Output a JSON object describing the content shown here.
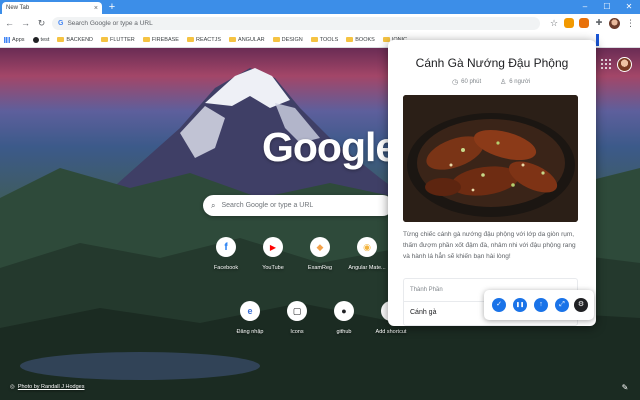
{
  "browser": {
    "tab": {
      "title": "New Tab",
      "close": "×"
    },
    "new_tab": "+",
    "window_controls": {
      "minimize": "–",
      "maximize": "☐",
      "close": "✕"
    },
    "omnibox": {
      "placeholder": "Search Google or type a URL"
    },
    "bookmarks": [
      {
        "label": "Apps",
        "icon": "apps-grid-icon"
      },
      {
        "label": "test",
        "icon": "site-icon"
      },
      {
        "label": "BACKEND",
        "icon": "folder-icon"
      },
      {
        "label": "FLUTTER",
        "icon": "folder-icon"
      },
      {
        "label": "FIREBASE",
        "icon": "folder-icon"
      },
      {
        "label": "REACTJS",
        "icon": "folder-icon"
      },
      {
        "label": "ANGULAR",
        "icon": "folder-icon"
      },
      {
        "label": "DESIGN",
        "icon": "folder-icon"
      },
      {
        "label": "TOOLS",
        "icon": "folder-icon"
      },
      {
        "label": "BOOKS",
        "icon": "folder-icon"
      },
      {
        "label": "IONIC",
        "icon": "folder-icon"
      }
    ]
  },
  "ntp": {
    "logo": "Google",
    "search_placeholder": "Search Google or type a URL",
    "shortcuts_row1": [
      {
        "label": "Facebook",
        "glyph": "f",
        "color": "#1877f2"
      },
      {
        "label": "YouTube",
        "glyph": "▶",
        "color": "#ff0000"
      },
      {
        "label": "ExamReg",
        "glyph": "◆",
        "color": "#f4a14a"
      },
      {
        "label": "Angular Mate...",
        "glyph": "◉",
        "color": "#f2b33d"
      }
    ],
    "shortcuts_row2": [
      {
        "label": "Đăng nhập",
        "glyph": "e",
        "color": "#3b6fd4"
      },
      {
        "label": "Icons",
        "glyph": "▢",
        "color": "#202124"
      },
      {
        "label": "github",
        "glyph": "●",
        "color": "#202124"
      },
      {
        "label": "Add shortcut",
        "glyph": "+",
        "color": "#202124"
      }
    ],
    "photo_credit": "Photo by Randall J Hodges",
    "photo_credit_icon": "◎",
    "edit_icon": "✎"
  },
  "recipe": {
    "title": "Cánh Gà Nướng Đậu Phộng",
    "time": "60 phút",
    "servings": "6 người",
    "description": "Từng chiếc cánh gà nướng đậu phộng với lớp da giòn rụm, thấm đượm phần xốt đậm đà, nhâm nhi với đậu phộng rang và hành lá hẳn sẽ khiến bạn hài lòng!",
    "ingredients_header": "Thành Phần",
    "ingredients": [
      "Cánh gà"
    ]
  },
  "fab_buttons": [
    {
      "icon": "check-icon",
      "glyph": "✓"
    },
    {
      "icon": "pause-icon",
      "glyph": "❚❚"
    },
    {
      "icon": "arrow-up-icon",
      "glyph": "↑"
    },
    {
      "icon": "fullscreen-icon",
      "glyph": "⤢"
    },
    {
      "icon": "settings-icon",
      "glyph": "⚙"
    }
  ],
  "colors": {
    "tabstrip": "#3c8ee8",
    "accent_blue": "#1a73e8",
    "dark": "#202124"
  }
}
